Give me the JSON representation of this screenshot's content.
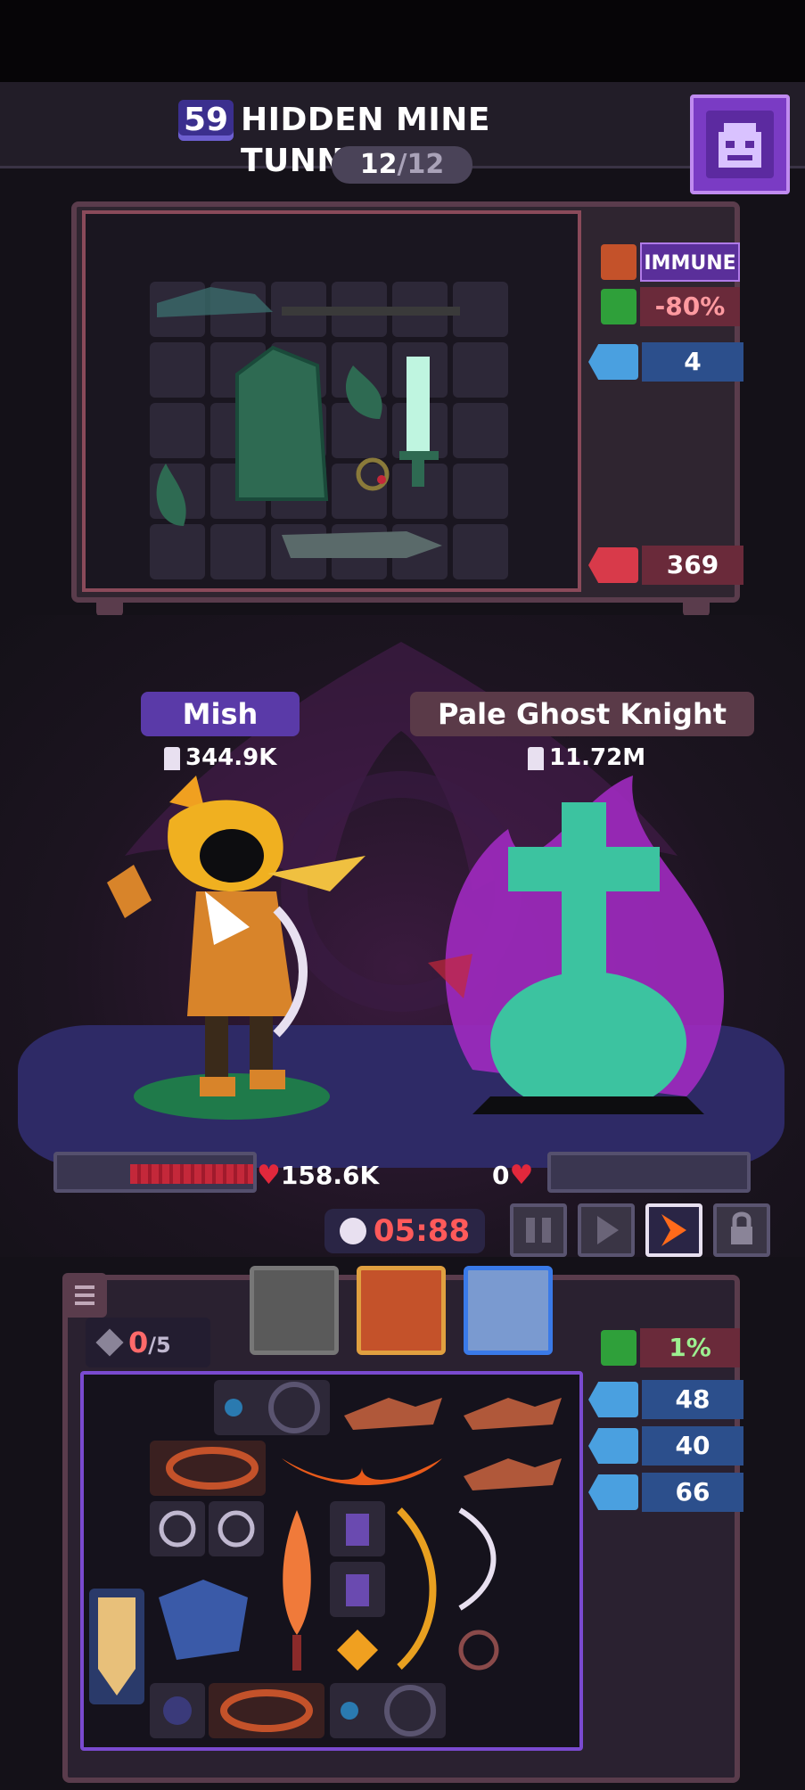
{
  "header": {
    "level": "59",
    "stage_title": "HIDDEN MINE TUNNEL",
    "wave_current": "12",
    "wave_separator": "/",
    "wave_total": "12"
  },
  "enemy_stats": {
    "immune_label": "IMMUNE",
    "reduction": "-80%",
    "attack": "4",
    "health": "369"
  },
  "battle": {
    "hero_name": "Mish",
    "hero_power": "344.9K",
    "enemy_name": "Pale Ghost Knight",
    "enemy_power": "11.72M",
    "hero_hp": "158.6K",
    "enemy_hp": "0",
    "timer": "05:88"
  },
  "player_stats": {
    "slots_used": "0",
    "slots_total": "/5",
    "regen": "1%",
    "attack": "48",
    "defense": "40",
    "speed": "66"
  },
  "colors": {
    "accent": "#7a3bc4",
    "hp": "#c4283a",
    "timer": "#ff5a5a",
    "stat_blue": "#2c4f8c",
    "stat_red": "#6a2a3a"
  },
  "icons": [
    "backpack-icon",
    "flame-icon",
    "heal-cross-icon",
    "fist-icon",
    "shield-icon",
    "sword-icon",
    "heart-icon",
    "skull-icon",
    "pause-icon",
    "play-icon",
    "fast-forward-icon",
    "lock-icon",
    "menu-icon",
    "gem-icon",
    "eye-icon",
    "boot-icon"
  ]
}
